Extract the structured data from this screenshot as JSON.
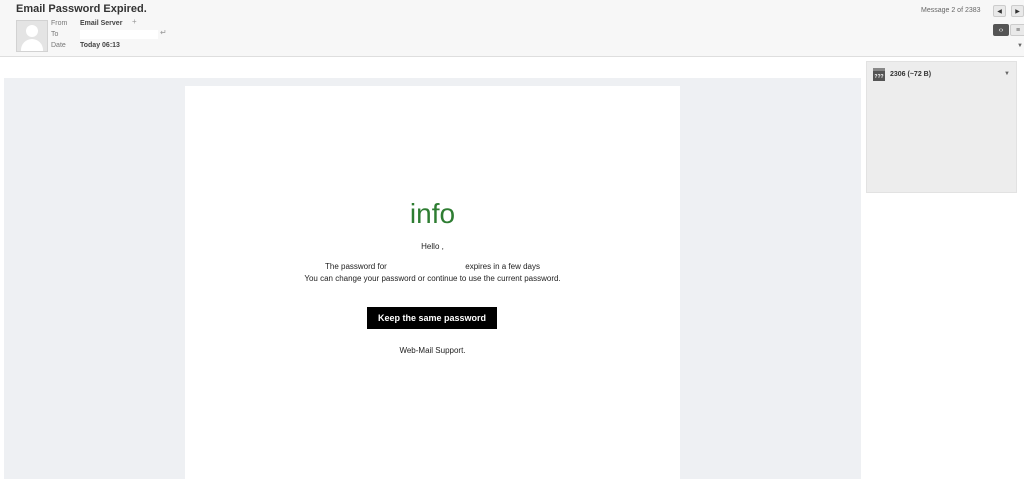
{
  "header": {
    "subject": "Email Password Expired.",
    "from_label": "From",
    "from_value": "Email Server",
    "to_label": "To",
    "date_label": "Date",
    "date_value": "Today 06:13",
    "message_counter": "Message 2 of 2383",
    "prev_icon": "◀",
    "next_icon": "▶",
    "view_html_icon": "‹›",
    "view_text_icon": "≡",
    "add_contact_icon": "+",
    "reply_icon": "↵",
    "collapse_icon": "▼"
  },
  "message": {
    "title": "info",
    "greeting": "Hello ,",
    "line1_start": "The password for",
    "line1_end": "expires in a few days",
    "line2": "You can change your password or continue to use the current password.",
    "button_label": "Keep the same password",
    "signature": "Web-Mail Support."
  },
  "attachment": {
    "icon_text": "???",
    "name": "2306 (~72 B)",
    "menu_icon": "▼"
  },
  "colors": {
    "title_green": "#2e7d32",
    "button_bg": "#000000",
    "frame_bg": "#eef0f3"
  }
}
